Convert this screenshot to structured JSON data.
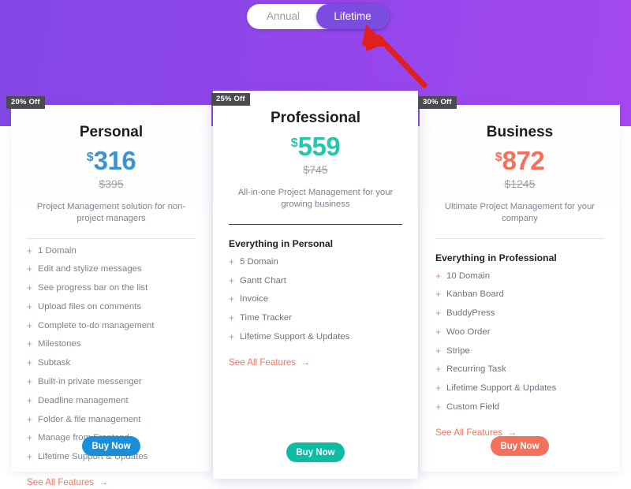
{
  "billing_toggle": {
    "annual_label": "Annual",
    "lifetime_label": "Lifetime",
    "selected": "Lifetime",
    "active_color": "#7b4ce0"
  },
  "pointer": {
    "name": "red-arrow-annotation",
    "color": "#e01f1f",
    "points_to": "Lifetime"
  },
  "plans": [
    {
      "badge": "20% Off",
      "title": "Personal",
      "currency": "$",
      "price": "316",
      "old_price": "$395",
      "description": "Project Management solution for non-project managers",
      "feature_heading": "",
      "features": [
        "1 Domain",
        "Edit and stylize messages",
        "See progress bar on the list",
        "Upload files on comments",
        "Complete to-do management",
        "Milestones",
        "Subtask",
        "Built-in private messenger",
        "Deadline management",
        "Folder & file management",
        "Manage from Frontend",
        "Lifetime Support & Updates"
      ],
      "see_all_label": "See All Features",
      "buy_label": "Buy Now",
      "accent_color": "#3d93cf",
      "button_color": "#1a8fd8"
    },
    {
      "badge": "25% Off",
      "title": "Professional",
      "currency": "$",
      "price": "559",
      "old_price": "$745",
      "description": "All-in-one Project Management for your growing business",
      "feature_heading": "Everything in Personal",
      "features": [
        "5 Domain",
        "Gantt Chart",
        "Invoice",
        "Time Tracker",
        "Lifetime Support & Updates"
      ],
      "see_all_label": "See All Features",
      "buy_label": "Buy Now",
      "accent_color": "#22c7b0",
      "button_color": "#0fbba2"
    },
    {
      "badge": "30% Off",
      "title": "Business",
      "currency": "$",
      "price": "872",
      "old_price": "$1245",
      "description": "Ultimate Project Management for your company",
      "feature_heading": "Everything in Professional",
      "features": [
        "10 Domain",
        "Kanban Board",
        "BuddyPress",
        "Woo Order",
        "Stripe",
        "Recurring Task",
        "Lifetime Support & Updates",
        "Custom Field"
      ],
      "see_all_label": "See All Features",
      "buy_label": "Buy Now",
      "accent_color": "#f4705a",
      "button_color": "#f4705a"
    }
  ],
  "theme": {
    "banner_from": "#8247e5",
    "banner_to": "#a348ee",
    "badge_bg": "#4b4b4f",
    "bullet_color": "#f4806f",
    "link_color": "#f07663"
  }
}
